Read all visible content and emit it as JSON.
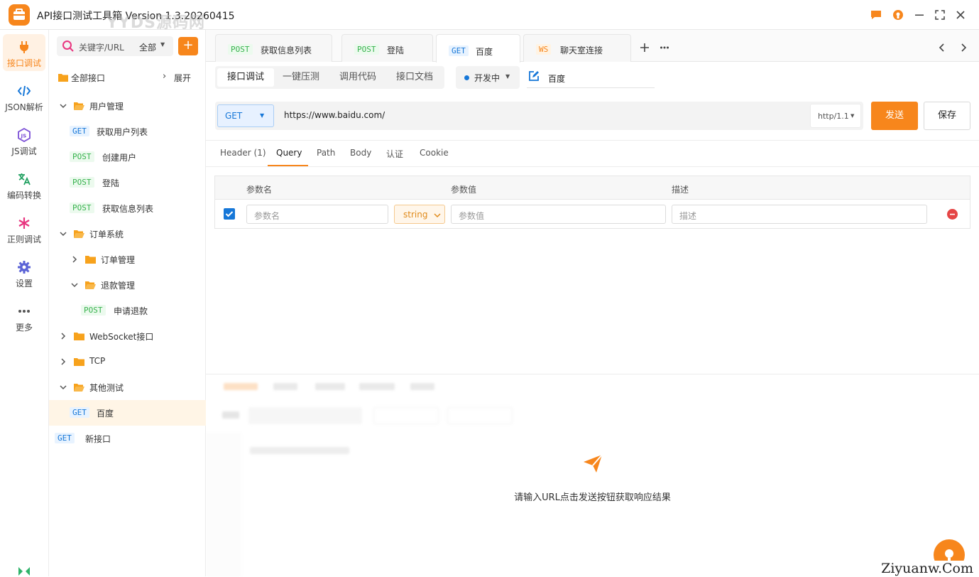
{
  "app": {
    "title": "API接口测试工具箱 Version 1.3.20260415",
    "watermark": "YYDS源码网",
    "site_watermark": "Ziyuanw.Com",
    "accent_color": "#f7861c",
    "window_controls": [
      "feedback-icon",
      "support-icon",
      "minimize-icon",
      "maximize-icon",
      "close-icon"
    ]
  },
  "rail": {
    "items": [
      {
        "label": "接口调试",
        "icon": "plug-icon",
        "active": true
      },
      {
        "label": "JSON解析",
        "icon": "code-icon"
      },
      {
        "label": "JS调试",
        "icon": "js-icon"
      },
      {
        "label": "编码转换",
        "icon": "translate-icon"
      },
      {
        "label": "正则调试",
        "icon": "asterisk-icon"
      },
      {
        "label": "设置",
        "icon": "gear-icon"
      },
      {
        "label": "更多",
        "icon": "more-icon"
      }
    ]
  },
  "tree": {
    "search_placeholder": "关键字/URL",
    "filter": "全部",
    "add_label": "+",
    "all_label": "全部接口",
    "expand_label": "展开",
    "nodes": [
      {
        "type": "folder",
        "label": "用户管理",
        "open": true
      },
      {
        "type": "api",
        "method": "GET",
        "label": "获取用户列表"
      },
      {
        "type": "api",
        "method": "POST",
        "label": "创建用户"
      },
      {
        "type": "api",
        "method": "POST",
        "label": "登陆"
      },
      {
        "type": "api",
        "method": "POST",
        "label": "获取信息列表"
      },
      {
        "type": "folder",
        "label": "订单系统",
        "open": true
      },
      {
        "type": "folder",
        "label": "订单管理",
        "open": false
      },
      {
        "type": "folder",
        "label": "退款管理",
        "open": true
      },
      {
        "type": "api",
        "method": "POST",
        "label": "申请退款"
      },
      {
        "type": "folder",
        "label": "WebSocket接口",
        "open": false
      },
      {
        "type": "folder",
        "label": "TCP",
        "open": false
      },
      {
        "type": "folder",
        "label": "其他测试",
        "open": true
      },
      {
        "type": "api",
        "method": "GET",
        "label": "百度",
        "selected": true
      },
      {
        "type": "api",
        "method": "GET",
        "label": "新接口"
      }
    ]
  },
  "tabs": [
    {
      "method": "POST",
      "label": "获取信息列表"
    },
    {
      "method": "POST",
      "label": "登陆"
    },
    {
      "method": "GET",
      "label": "百度",
      "active": true
    },
    {
      "method": "WS",
      "label": "聊天室连接"
    }
  ],
  "subtabs": [
    "接口调试",
    "一键压测",
    "调用代码",
    "接口文档"
  ],
  "env": "开发中",
  "request_name": "百度",
  "request": {
    "method": "GET",
    "url": "https://www.baidu.com/",
    "http_version": "http/1.1",
    "send_label": "发送",
    "save_label": "保存"
  },
  "param_tabs": [
    "Header (1)",
    "Query",
    "Path",
    "Body",
    "认证",
    "Cookie"
  ],
  "active_param_tab": "Query",
  "params": {
    "headers": [
      "参数名",
      "参数值",
      "描述"
    ],
    "row": {
      "checked": true,
      "name_placeholder": "参数名",
      "type": "string",
      "value_placeholder": "参数值",
      "desc_placeholder": "描述"
    }
  },
  "response": {
    "empty_message": "请输入URL点击发送按钮获取响应结果"
  }
}
